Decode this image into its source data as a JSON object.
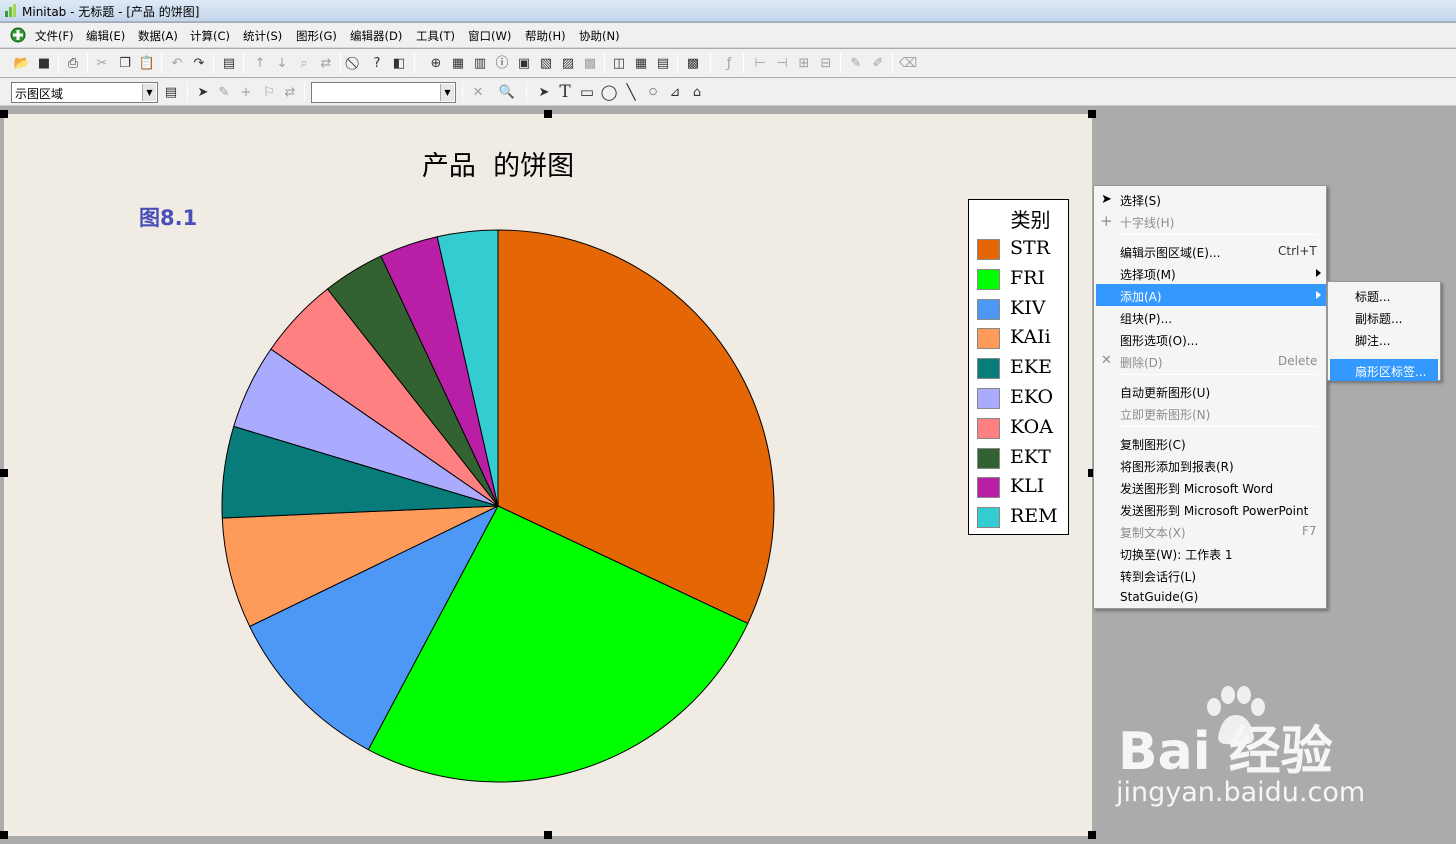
{
  "window": {
    "title": "Minitab - 无标题 - [产品 的饼图]"
  },
  "menubar": [
    {
      "label": "文件(F)"
    },
    {
      "label": "编辑(E)"
    },
    {
      "label": "数据(A)"
    },
    {
      "label": "计算(C)"
    },
    {
      "label": "统计(S)"
    },
    {
      "label": "图形(G)"
    },
    {
      "label": "编辑器(D)"
    },
    {
      "label": "工具(T)"
    },
    {
      "label": "窗口(W)"
    },
    {
      "label": "帮助(H)"
    },
    {
      "label": "协助(N)"
    }
  ],
  "toolbar2": {
    "region_select": "示图区域",
    "second_select": ""
  },
  "graph": {
    "title": "产品  的饼图",
    "figure_label": "图8.1"
  },
  "chart_data": {
    "type": "pie",
    "title": "产品  的饼图",
    "legend_title": "类别",
    "legend_position": "right",
    "categories": [
      "STR",
      "FRI",
      "KIV",
      "KAIi",
      "EKE",
      "EKO",
      "KOA",
      "EKT",
      "KLI",
      "REM"
    ],
    "values": [
      33.5,
      27.0,
      10.5,
      6.8,
      5.6,
      5.2,
      5.0,
      3.8,
      3.6,
      3.7
    ],
    "colors": [
      "#e46604",
      "#00ff00",
      "#4d97f5",
      "#ff9b5a",
      "#087c7a",
      "#aaaaff",
      "#ff8080",
      "#326232",
      "#b91fa6",
      "#33ccd0"
    ]
  },
  "context_menu": {
    "items": [
      {
        "label": "选择(S)",
        "icon": "pointer-icon"
      },
      {
        "label": "十字线(H)",
        "icon": "crosshair-icon",
        "disabled": true
      },
      {
        "label": "编辑示图区域(E)...",
        "shortcut": "Ctrl+T"
      },
      {
        "label": "选择项(M)",
        "submenu": true
      },
      {
        "label": "添加(A)",
        "submenu": true,
        "highlighted": true
      },
      {
        "label": "组块(P)..."
      },
      {
        "label": "图形选项(O)..."
      },
      {
        "label": "删除(D)",
        "shortcut": "Delete",
        "disabled": true,
        "icon": "delete-x-icon"
      },
      {
        "label": "自动更新图形(U)"
      },
      {
        "label": "立即更新图形(N)",
        "disabled": true
      },
      {
        "label": "复制图形(C)"
      },
      {
        "label": "将图形添加到报表(R)"
      },
      {
        "label": "发送图形到 Microsoft Word"
      },
      {
        "label": "发送图形到 Microsoft PowerPoint"
      },
      {
        "label": "复制文本(X)",
        "shortcut": "F7",
        "disabled": true
      },
      {
        "label": "切换至(W): 工作表 1"
      },
      {
        "label": "转到会话行(L)"
      },
      {
        "label": "StatGuide(G)"
      }
    ]
  },
  "submenu": {
    "items": [
      {
        "label": "标题..."
      },
      {
        "label": "副标题..."
      },
      {
        "label": "脚注..."
      },
      {
        "label": "扇形区标签...",
        "highlighted": true
      }
    ]
  },
  "watermark": {
    "line1": "Bai 经验",
    "line2": "jingyan.baidu.com"
  }
}
